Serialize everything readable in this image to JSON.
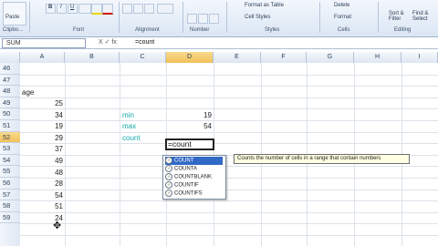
{
  "ribbon": {
    "groups": [
      "Clipbo...",
      "Font",
      "Alignment",
      "Number",
      "Styles",
      "Cells",
      "Editing"
    ],
    "paste_label": "Paste",
    "font_buttons": [
      "B",
      "I",
      "U"
    ],
    "format_table": "Format as Table",
    "cell_styles": "Cell Styles",
    "delete": "Delete",
    "format": "Format",
    "sort_filter": "Sort & Filter",
    "find_select": "Find & Select"
  },
  "formula_bar": {
    "name_box": "SUM",
    "fx": "X ✓ fx",
    "formula": "=count"
  },
  "grid": {
    "columns": [
      "A",
      "B",
      "C",
      "D",
      "E",
      "F",
      "G",
      "H",
      "I"
    ],
    "selected_column": "D",
    "rows": [
      "46",
      "47",
      "48",
      "49",
      "50",
      "51",
      "52",
      "53",
      "54",
      "55",
      "56",
      "57",
      "58",
      "59"
    ],
    "selected_row": "52",
    "a_header": "age",
    "a_values": [
      "25",
      "34",
      "19",
      "29",
      "37",
      "49",
      "48",
      "28",
      "54",
      "51",
      "24"
    ],
    "c_labels": [
      "min",
      "max",
      "count"
    ],
    "d_values": [
      "19",
      "54"
    ],
    "active_text": "=count"
  },
  "autocomplete": {
    "items": [
      "COUNT",
      "COUNTA",
      "COUNTBLANK",
      "COUNTIF",
      "COUNTIFS"
    ],
    "tooltip": "Counts the number of cells in a range that contain numbers"
  },
  "colors": {
    "ribbon": "#dbe6f4",
    "label_text": "#16a9a9",
    "highlight": "#3169c6",
    "selected_header": "#f1c15a"
  }
}
